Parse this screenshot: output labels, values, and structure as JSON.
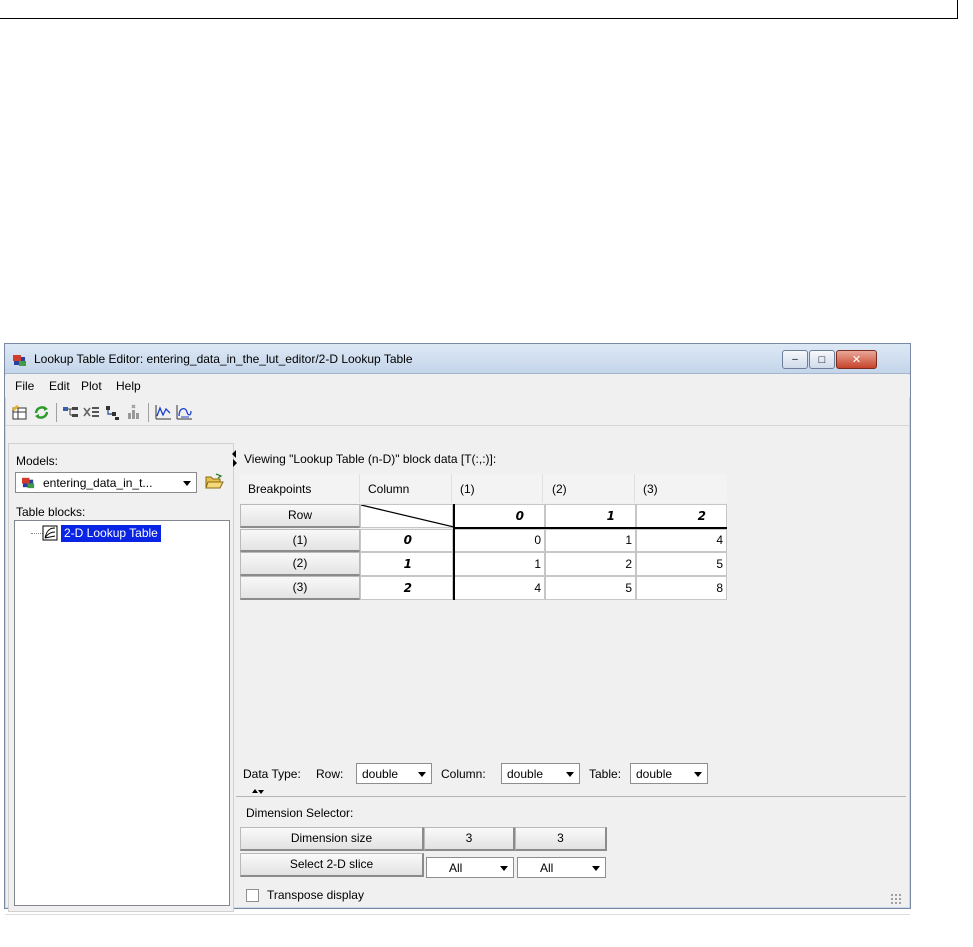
{
  "window": {
    "title": "Lookup Table Editor: entering_data_in_the_lut_editor/2-D Lookup Table",
    "minimize_symbol": "–",
    "maximize_symbol": "□",
    "close_symbol": "✕"
  },
  "menu": [
    "File",
    "Edit",
    "Plot",
    "Help"
  ],
  "toolbar": {
    "icons": [
      "table-icon",
      "refresh-icon",
      "tree-icon",
      "delete-icon",
      "arrange-icon",
      "stack-icon",
      "line-plot-icon",
      "mesh-plot-icon"
    ]
  },
  "left": {
    "models_label": "Models:",
    "model_value": "entering_data_in_t...",
    "table_blocks_label": "Table blocks:",
    "tree_item": "2-D Lookup Table"
  },
  "view": {
    "caption": "Viewing \"Lookup Table (n-D)\" block data [T(:,:)]:",
    "header": [
      "Breakpoints",
      "Column",
      "(1)",
      "(2)",
      "(3)"
    ],
    "row_label": "Row",
    "column_breakpoints": [
      "0",
      "1",
      "2"
    ],
    "rows": [
      {
        "label": "(1)",
        "breakpoint": "0",
        "values": [
          "0",
          "1",
          "4"
        ]
      },
      {
        "label": "(2)",
        "breakpoint": "1",
        "values": [
          "1",
          "2",
          "5"
        ]
      },
      {
        "label": "(3)",
        "breakpoint": "2",
        "values": [
          "4",
          "5",
          "8"
        ]
      }
    ]
  },
  "data_type": {
    "label": "Data Type:",
    "row_label": "Row:",
    "row_value": "double",
    "column_label": "Column:",
    "column_value": "double",
    "table_label": "Table:",
    "table_value": "double"
  },
  "dimension": {
    "title": "Dimension Selector:",
    "size_label": "Dimension size",
    "sizes": [
      "3",
      "3"
    ],
    "slice_label": "Select 2-D slice",
    "slices": [
      "All",
      "All"
    ],
    "transpose_label": "Transpose display"
  }
}
